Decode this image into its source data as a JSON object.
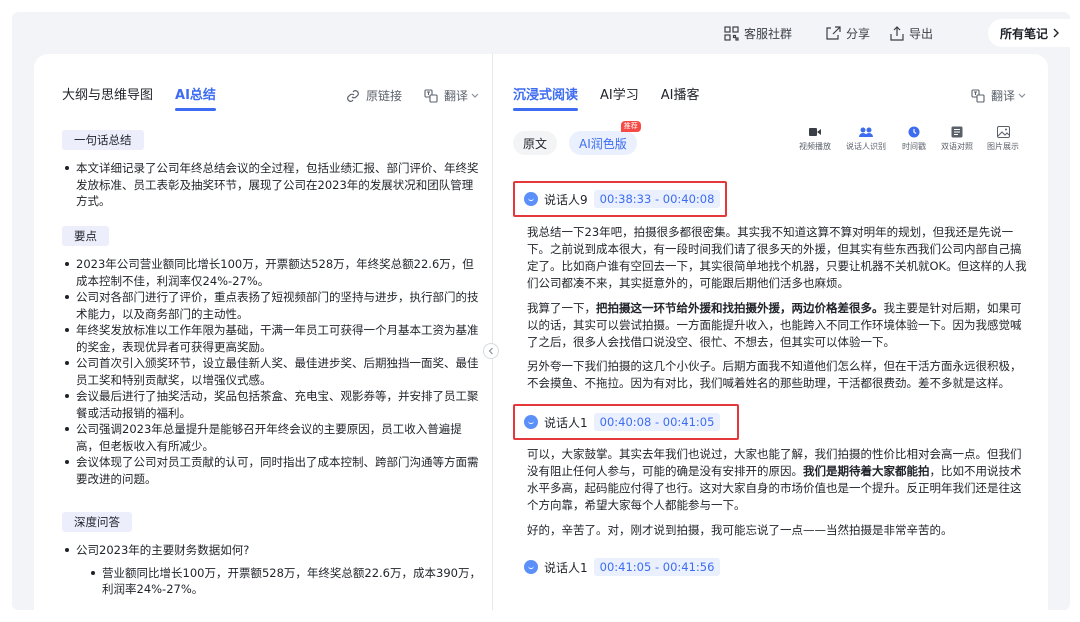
{
  "topbar": {
    "service_community": "客服社群",
    "share": "分享",
    "export": "导出",
    "all_notes": "所有笔记"
  },
  "left": {
    "tabs": [
      {
        "label": "大纲与思维导图",
        "active": false
      },
      {
        "label": "AI总结",
        "active": true
      }
    ],
    "original_link": "原链接",
    "translate": "翻译",
    "sections": {
      "one_sentence": {
        "title": "一句话总结",
        "items": [
          "本文详细记录了公司年终总结会议的全过程，包括业绩汇报、部门评价、年终奖发放标准、员工表彰及抽奖环节，展现了公司在2023年的发展状况和团队管理方式。"
        ]
      },
      "key_points": {
        "title": "要点",
        "items": [
          "2023年公司营业额同比增长100万，开票额达528万，年终奖总额22.6万，但成本控制不佳，利润率仅24%-27%。",
          "公司对各部门进行了评价，重点表扬了短视频部门的坚持与进步，执行部门的技术能力，以及商务部门的主动性。",
          "年终奖发放标准以工作年限为基础，干满一年员工可获得一个月基本工资为基准的奖金，表现优异者可获得更高奖励。",
          "公司首次引入颁奖环节，设立最佳新人奖、最佳进步奖、后期独挡一面奖、最佳员工奖和特别贡献奖，以增强仪式感。",
          "会议最后进行了抽奖活动，奖品包括茶盒、充电宝、观影券等，并安排了员工聚餐或活动报销的福利。",
          "公司强调2023年总量提升是能够召开年终会议的主要原因，员工收入普遍提高，但老板收入有所减少。",
          "会议体现了公司对员工贡献的认可，同时指出了成本控制、跨部门沟通等方面需要改进的问题。"
        ]
      },
      "deep_qa": {
        "title": "深度问答",
        "question": "公司2023年的主要财务数据如何?",
        "answer": "营业额同比增长100万，开票额528万，年终奖总额22.6万，成本390万，利润率24%-27%。"
      }
    }
  },
  "right": {
    "tabs": [
      {
        "label": "沉浸式阅读",
        "active": true
      },
      {
        "label": "AI学习",
        "active": false
      },
      {
        "label": "AI播客",
        "active": false
      }
    ],
    "translate": "翻译",
    "versions": {
      "original": "原文",
      "ai_polished": "AI润色版",
      "badge": "推荐"
    },
    "tools": [
      {
        "label": "视频播放",
        "icon": "video-icon"
      },
      {
        "label": "说话人识别",
        "icon": "speakers-icon"
      },
      {
        "label": "时间戳",
        "icon": "clock-icon"
      },
      {
        "label": "双语对照",
        "icon": "bilingual-icon"
      },
      {
        "label": "图片展示",
        "icon": "image-icon"
      }
    ],
    "segments": [
      {
        "speaker": "说话人9",
        "time": "00:38:33 - 00:40:08",
        "paragraphs": [
          {
            "text": "我总结一下23年吧，拍摄很多都很密集。其实我不知道这算不算对明年的规划，但我还是先说一下。之前说到成本很大，有一段时间我们请了很多天的外援，但其实有些东西我们公司内部自己搞定了。比如商户谁有空回去一下，其实很简单地找个机器，只要让机器不关机就OK。但这样的人我们公司都凑不来，其实挺意外的，可能跟后期他们活多也麻烦。"
          },
          {
            "before": "我算了一下，",
            "bold": "把拍摄这一环节给外援和找拍摄外援，两边价格差很多。",
            "after": "我主要是针对后期，如果可以的话，其实可以尝试拍摄。一方面能提升收入，也能跨入不同工作环境体验一下。因为我感觉喊了之后，很多人会找借口说没空、很忙、不想去，但其实可以体验一下。"
          },
          {
            "text": "另外夸一下我们拍摄的这几个小伙子。后期方面我不知道他们怎么样，但在干活方面永远很积极，不会摸鱼、不拖拉。因为有对比，我们喊着姓名的那些助理，干活都很费劲。差不多就是这样。"
          }
        ]
      },
      {
        "speaker": "说话人1",
        "time": "00:40:08 - 00:41:05",
        "paragraphs": [
          {
            "before": "可以，大家鼓掌。其实去年我们也说过，大家也能了解，我们拍摄的性价比相对会高一点。但我们没有阻止任何人参与，可能的确是没有安排开的原因。",
            "bold": "我们是期待着大家都能拍",
            "after": "，比如不用说技术水平多高，起码能应付得了也行。这对大家自身的市场价值也是一个提升。反正明年我们还是往这个方向靠，希望大家每个人都能参与一下。"
          },
          {
            "text": "好的，辛苦了。对，刚才说到拍摄，我可能忘说了一点——当然拍摄是非常辛苦的。"
          }
        ]
      },
      {
        "speaker": "说话人1",
        "time": "00:41:05 - 00:41:56",
        "paragraphs": []
      }
    ]
  },
  "colors": {
    "accent": "#3d6cf2",
    "highlight_border": "#e5383b",
    "tag_bg": "#eceefb"
  }
}
